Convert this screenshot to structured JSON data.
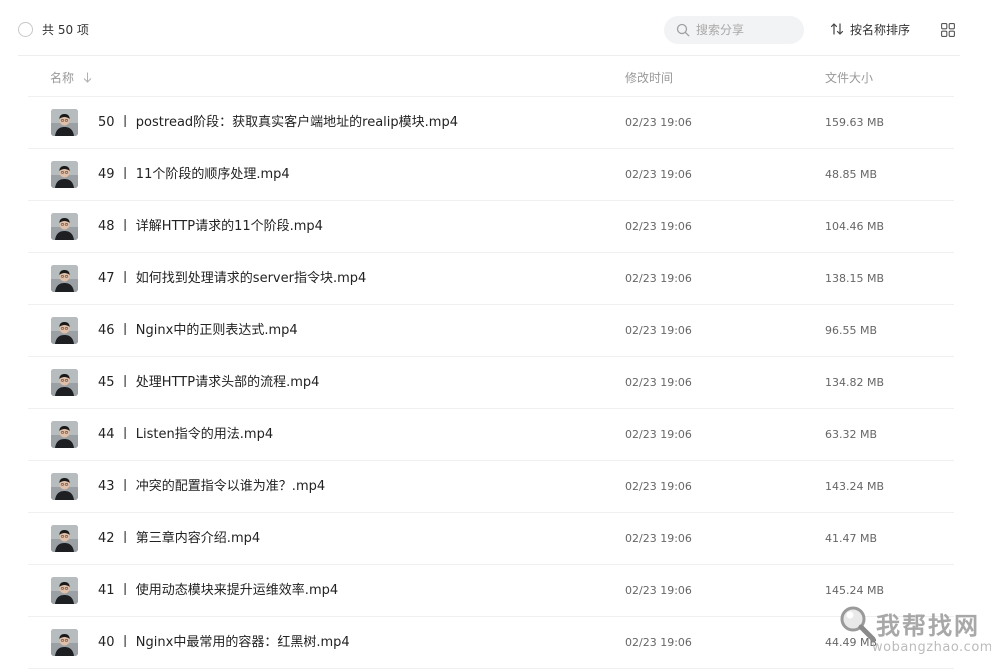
{
  "toolbar": {
    "total_label": "共 50 项",
    "search_placeholder": "搜索分享",
    "sort_label": "按名称排序"
  },
  "table": {
    "col_name": "名称",
    "col_time": "修改时间",
    "col_size": "文件大小"
  },
  "files": [
    {
      "name": "50 丨 postread阶段：获取真实客户端地址的realip模块.mp4",
      "time": "02/23 19:06",
      "size": "159.63 MB"
    },
    {
      "name": "49 丨 11个阶段的顺序处理.mp4",
      "time": "02/23 19:06",
      "size": "48.85 MB"
    },
    {
      "name": "48 丨 详解HTTP请求的11个阶段.mp4",
      "time": "02/23 19:06",
      "size": "104.46 MB"
    },
    {
      "name": "47 丨 如何找到处理请求的server指令块.mp4",
      "time": "02/23 19:06",
      "size": "138.15 MB"
    },
    {
      "name": "46 丨 Nginx中的正则表达式.mp4",
      "time": "02/23 19:06",
      "size": "96.55 MB"
    },
    {
      "name": "45 丨 处理HTTP请求头部的流程.mp4",
      "time": "02/23 19:06",
      "size": "134.82 MB"
    },
    {
      "name": "44 丨 Listen指令的用法.mp4",
      "time": "02/23 19:06",
      "size": "63.32 MB"
    },
    {
      "name": "43 丨 冲突的配置指令以谁为准？.mp4",
      "time": "02/23 19:06",
      "size": "143.24 MB"
    },
    {
      "name": "42 丨 第三章内容介绍.mp4",
      "time": "02/23 19:06",
      "size": "41.47 MB"
    },
    {
      "name": "41 丨 使用动态模块来提升运维效率.mp4",
      "time": "02/23 19:06",
      "size": "145.24 MB"
    },
    {
      "name": "40 丨 Nginx中最常用的容器：红黑树.mp4",
      "time": "02/23 19:06",
      "size": "44.49 MB"
    }
  ],
  "watermark": {
    "main": "我帮找网",
    "sub": "wobangzhao.com"
  },
  "icons": {
    "search": "search-icon",
    "sort": "sort-icon",
    "grid": "grid-view-icon",
    "arrow": "arrow-down-icon",
    "thumb": "video-thumbnail"
  },
  "colors": {
    "accent_bg": "#f2f3f5",
    "text": "#222222",
    "muted": "#999999",
    "divider": "#f0f0f0"
  }
}
